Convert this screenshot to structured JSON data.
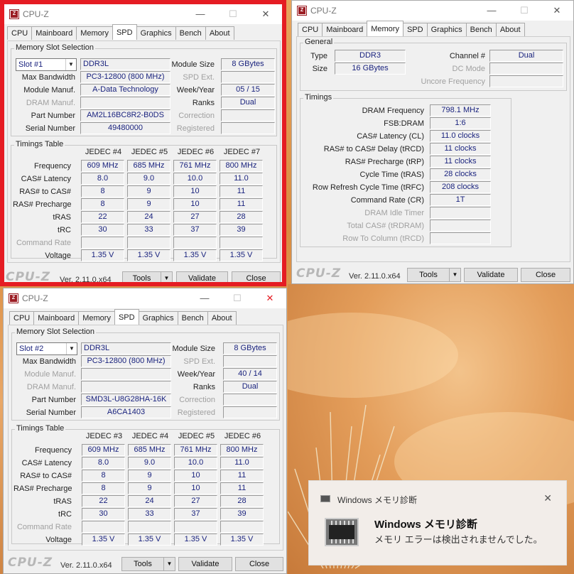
{
  "app": {
    "title": "CPU-Z",
    "logo": "CPU-Z",
    "version": "Ver. 2.11.0.x64",
    "tools": "Tools",
    "validate": "Validate",
    "close": "Close",
    "tabs": [
      "CPU",
      "Mainboard",
      "Memory",
      "SPD",
      "Graphics",
      "Bench",
      "About"
    ]
  },
  "spd1": {
    "group_slot": "Memory Slot Selection",
    "slot": "Slot #1",
    "type": "DDR3L",
    "module_size_label": "Module Size",
    "module_size": "8 GBytes",
    "max_bw_label": "Max Bandwidth",
    "max_bw": "PC3-12800 (800 MHz)",
    "spd_ext_label": "SPD Ext.",
    "spd_ext": "",
    "module_manuf_label": "Module Manuf.",
    "module_manuf": "A-Data Technology",
    "week_year_label": "Week/Year",
    "week_year": "05 / 15",
    "dram_manuf_label": "DRAM Manuf.",
    "dram_manuf": "",
    "ranks_label": "Ranks",
    "ranks": "Dual",
    "part_label": "Part Number",
    "part": "AM2L16BC8R2-B0DS",
    "correction_label": "Correction",
    "correction": "",
    "serial_label": "Serial Number",
    "serial": "49480000",
    "registered_label": "Registered",
    "registered": "",
    "timings_title": "Timings Table",
    "cols": [
      "JEDEC #4",
      "JEDEC #5",
      "JEDEC #6",
      "JEDEC #7"
    ],
    "rows": [
      {
        "label": "Frequency",
        "v": [
          "609 MHz",
          "685 MHz",
          "761 MHz",
          "800 MHz"
        ]
      },
      {
        "label": "CAS# Latency",
        "v": [
          "8.0",
          "9.0",
          "10.0",
          "11.0"
        ]
      },
      {
        "label": "RAS# to CAS#",
        "v": [
          "8",
          "9",
          "10",
          "11"
        ]
      },
      {
        "label": "RAS# Precharge",
        "v": [
          "8",
          "9",
          "10",
          "11"
        ]
      },
      {
        "label": "tRAS",
        "v": [
          "22",
          "24",
          "27",
          "28"
        ]
      },
      {
        "label": "tRC",
        "v": [
          "30",
          "33",
          "37",
          "39"
        ]
      },
      {
        "label": "Command Rate",
        "v": [
          "",
          "",
          "",
          ""
        ]
      },
      {
        "label": "Voltage",
        "v": [
          "1.35 V",
          "1.35 V",
          "1.35 V",
          "1.35 V"
        ]
      }
    ]
  },
  "spd2": {
    "slot": "Slot #2",
    "type": "DDR3L",
    "module_size": "8 GBytes",
    "max_bw": "PC3-12800 (800 MHz)",
    "module_manuf": "",
    "week_year": "40 / 14",
    "dram_manuf": "",
    "ranks": "Dual",
    "part": "SMD3L-U8G28HA-16K",
    "serial": "A6CA1403",
    "cols": [
      "JEDEC #3",
      "JEDEC #4",
      "JEDEC #5",
      "JEDEC #6"
    ],
    "rows": [
      {
        "label": "Frequency",
        "v": [
          "609 MHz",
          "685 MHz",
          "761 MHz",
          "800 MHz"
        ]
      },
      {
        "label": "CAS# Latency",
        "v": [
          "8.0",
          "9.0",
          "10.0",
          "11.0"
        ]
      },
      {
        "label": "RAS# to CAS#",
        "v": [
          "8",
          "9",
          "10",
          "11"
        ]
      },
      {
        "label": "RAS# Precharge",
        "v": [
          "8",
          "9",
          "10",
          "11"
        ]
      },
      {
        "label": "tRAS",
        "v": [
          "22",
          "24",
          "27",
          "28"
        ]
      },
      {
        "label": "tRC",
        "v": [
          "30",
          "33",
          "37",
          "39"
        ]
      },
      {
        "label": "Command Rate",
        "v": [
          "",
          "",
          "",
          ""
        ]
      },
      {
        "label": "Voltage",
        "v": [
          "1.35 V",
          "1.35 V",
          "1.35 V",
          "1.35 V"
        ]
      }
    ]
  },
  "mem": {
    "general_title": "General",
    "type_label": "Type",
    "type": "DDR3",
    "channel_label": "Channel #",
    "channel": "Dual",
    "size_label": "Size",
    "size": "16 GBytes",
    "dc_mode_label": "DC Mode",
    "dc_mode": "",
    "uncore_label": "Uncore Frequency",
    "uncore": "",
    "timings_title": "Timings",
    "timings": [
      {
        "label": "DRAM Frequency",
        "v": "798.1 MHz",
        "dis": false
      },
      {
        "label": "FSB:DRAM",
        "v": "1:6",
        "dis": false
      },
      {
        "label": "CAS# Latency (CL)",
        "v": "11.0 clocks",
        "dis": false
      },
      {
        "label": "RAS# to CAS# Delay (tRCD)",
        "v": "11 clocks",
        "dis": false
      },
      {
        "label": "RAS# Precharge (tRP)",
        "v": "11 clocks",
        "dis": false
      },
      {
        "label": "Cycle Time (tRAS)",
        "v": "28 clocks",
        "dis": false
      },
      {
        "label": "Row Refresh Cycle Time (tRFC)",
        "v": "208 clocks",
        "dis": false
      },
      {
        "label": "Command Rate (CR)",
        "v": "1T",
        "dis": false
      },
      {
        "label": "DRAM Idle Timer",
        "v": "",
        "dis": true
      },
      {
        "label": "Total CAS# (tRDRAM)",
        "v": "",
        "dis": true
      },
      {
        "label": "Row To Column (tRCD)",
        "v": "",
        "dis": true
      }
    ]
  },
  "toast": {
    "app": "Windows メモリ診断",
    "title": "Windows メモリ診断",
    "message": "メモリ エラーは検出されませんでした。"
  },
  "colors": {
    "highlight_border": "#e51c23",
    "value_text": "#1a237e"
  }
}
